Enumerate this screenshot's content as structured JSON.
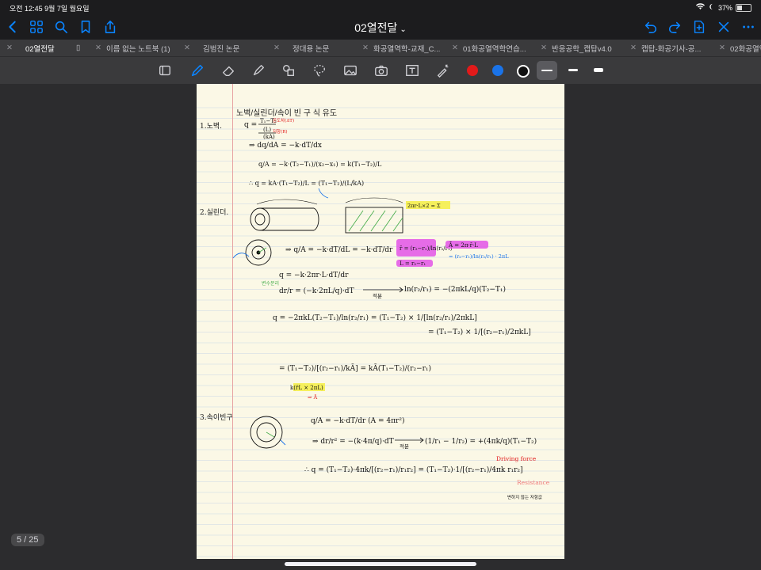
{
  "status_bar": {
    "time_date": "오전 12:45   9월 7일 월요일",
    "battery": "37%",
    "battery_level": 0.37
  },
  "nav": {
    "title": "02열전달"
  },
  "tabs": [
    {
      "label": "02열전달",
      "active": true
    },
    {
      "label": "이름 없는 노트북 (1)",
      "active": false
    },
    {
      "label": "김범진 논문",
      "active": false
    },
    {
      "label": "정대용 논문",
      "active": false
    },
    {
      "label": "화공열역학-교재_C...",
      "active": false
    },
    {
      "label": "01화공열역학연습...",
      "active": false
    },
    {
      "label": "반응공학_캡탑v4.0",
      "active": false
    },
    {
      "label": "캡탑-화공기사-공...",
      "active": false
    },
    {
      "label": "02화공열역",
      "active": false
    }
  ],
  "colors": {
    "accent": "#0a84ff",
    "swatch_red": "#e21a1a",
    "swatch_blue": "#1a73e8",
    "swatch_black": "#111111",
    "page_bg": "#fbf8e6",
    "rule_line": "#c9d6e6",
    "margin_line": "#e7a3a3"
  },
  "page": {
    "heading": "노벽/실린더/속이 빈 구 식 유도",
    "sections": [
      {
        "number": "1.",
        "title": "노벽."
      },
      {
        "number": "2.",
        "title": "실린더."
      },
      {
        "number": "3.",
        "title": "속이빈구"
      }
    ],
    "annotations": {
      "integrate": "적분",
      "integrate_2": "적분",
      "driving_force": "Driving force",
      "resistance": "Resistance",
      "variable_sep": "변수분리",
      "note_bottom": "변하지 않는 저항값"
    }
  },
  "counter": "5 / 25"
}
